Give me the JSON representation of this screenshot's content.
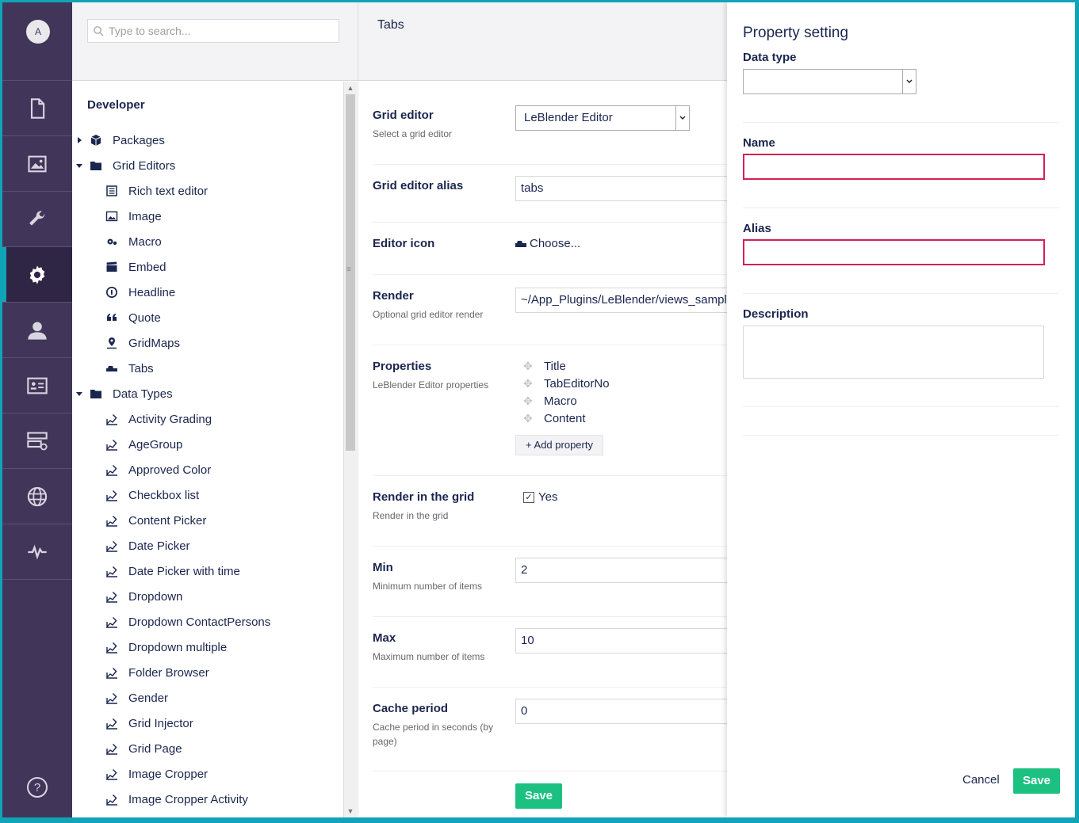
{
  "user": {
    "avatar_initial": "A"
  },
  "nav": {
    "items": [
      {
        "name": "content",
        "icon": "document-icon"
      },
      {
        "name": "media",
        "icon": "image-icon"
      },
      {
        "name": "settings",
        "icon": "wrench-icon"
      },
      {
        "name": "developer",
        "icon": "gear-icon",
        "active": true
      },
      {
        "name": "users",
        "icon": "user-icon"
      },
      {
        "name": "members",
        "icon": "id-card-icon"
      },
      {
        "name": "forms",
        "icon": "form-icon"
      },
      {
        "name": "translation",
        "icon": "globe-icon"
      },
      {
        "name": "analytics",
        "icon": "pulse-icon"
      }
    ],
    "help_icon": "help-icon"
  },
  "search": {
    "placeholder": "Type to search..."
  },
  "tree": {
    "title": "Developer",
    "items": [
      {
        "label": "Packages",
        "level": 0,
        "caret": "right",
        "icon": "package-icon"
      },
      {
        "label": "Grid Editors",
        "level": 0,
        "caret": "down",
        "icon": "folder-icon"
      },
      {
        "label": "Rich text editor",
        "level": 1,
        "icon": "rte-icon"
      },
      {
        "label": "Image",
        "level": 1,
        "icon": "picture-icon"
      },
      {
        "label": "Macro",
        "level": 1,
        "icon": "settings-icon"
      },
      {
        "label": "Embed",
        "level": 1,
        "icon": "movie-icon"
      },
      {
        "label": "Headline",
        "level": 1,
        "icon": "info-circle-icon"
      },
      {
        "label": "Quote",
        "level": 1,
        "icon": "quote-icon"
      },
      {
        "label": "GridMaps",
        "level": 1,
        "icon": "map-pin-icon"
      },
      {
        "label": "Tabs",
        "level": 1,
        "icon": "tab-icon"
      },
      {
        "label": "Data Types",
        "level": 0,
        "caret": "down",
        "icon": "folder-icon"
      },
      {
        "label": "Activity Grading",
        "level": 1,
        "icon": "autofill-icon"
      },
      {
        "label": "AgeGroup",
        "level": 1,
        "icon": "autofill-icon"
      },
      {
        "label": "Approved Color",
        "level": 1,
        "icon": "autofill-icon"
      },
      {
        "label": "Checkbox list",
        "level": 1,
        "icon": "autofill-icon"
      },
      {
        "label": "Content Picker",
        "level": 1,
        "icon": "autofill-icon"
      },
      {
        "label": "Date Picker",
        "level": 1,
        "icon": "autofill-icon"
      },
      {
        "label": "Date Picker with time",
        "level": 1,
        "icon": "autofill-icon"
      },
      {
        "label": "Dropdown",
        "level": 1,
        "icon": "autofill-icon"
      },
      {
        "label": "Dropdown ContactPersons",
        "level": 1,
        "icon": "autofill-icon"
      },
      {
        "label": "Dropdown multiple",
        "level": 1,
        "icon": "autofill-icon"
      },
      {
        "label": "Folder Browser",
        "level": 1,
        "icon": "autofill-icon"
      },
      {
        "label": "Gender",
        "level": 1,
        "icon": "autofill-icon"
      },
      {
        "label": "Grid Injector",
        "level": 1,
        "icon": "autofill-icon"
      },
      {
        "label": "Grid Page",
        "level": 1,
        "icon": "autofill-icon"
      },
      {
        "label": "Image Cropper",
        "level": 1,
        "icon": "autofill-icon"
      },
      {
        "label": "Image Cropper Activity",
        "level": 1,
        "icon": "autofill-icon"
      }
    ]
  },
  "editor": {
    "title": "Tabs",
    "grid_editor": {
      "label": "Grid editor",
      "desc": "Select a grid editor",
      "value": "LeBlender Editor"
    },
    "alias": {
      "label": "Grid editor alias",
      "value": "tabs"
    },
    "icon": {
      "label": "Editor icon",
      "choose": "Choose..."
    },
    "render": {
      "label": "Render",
      "desc": "Optional grid editor render",
      "value": "~/App_Plugins/LeBlender/views_sample"
    },
    "properties": {
      "label": "Properties",
      "desc": "LeBlender Editor properties",
      "items": [
        "Title",
        "TabEditorNo",
        "Macro",
        "Content"
      ],
      "add_label": "Add property"
    },
    "render_in_grid": {
      "label": "Render in the grid",
      "desc": "Render in the grid",
      "value": "Yes",
      "checked": true
    },
    "min": {
      "label": "Min",
      "desc": "Minimum number of items",
      "value": "2"
    },
    "max": {
      "label": "Max",
      "desc": "Maximum number of items",
      "value": "10"
    },
    "cache": {
      "label": "Cache period",
      "desc": "Cache period in seconds (by page)",
      "value": "0"
    },
    "save_label": "Save"
  },
  "panel": {
    "title": "Property setting",
    "data_type_label": "Data type",
    "data_type_value": "",
    "name_label": "Name",
    "name_value": "",
    "alias_label": "Alias",
    "alias_value": "",
    "description_label": "Description",
    "description_value": "",
    "cancel_label": "Cancel",
    "save_label": "Save"
  },
  "colors": {
    "nav_bg": "#413659",
    "accent": "#0fa4b8",
    "save": "#1cc081",
    "error": "#d42054"
  }
}
